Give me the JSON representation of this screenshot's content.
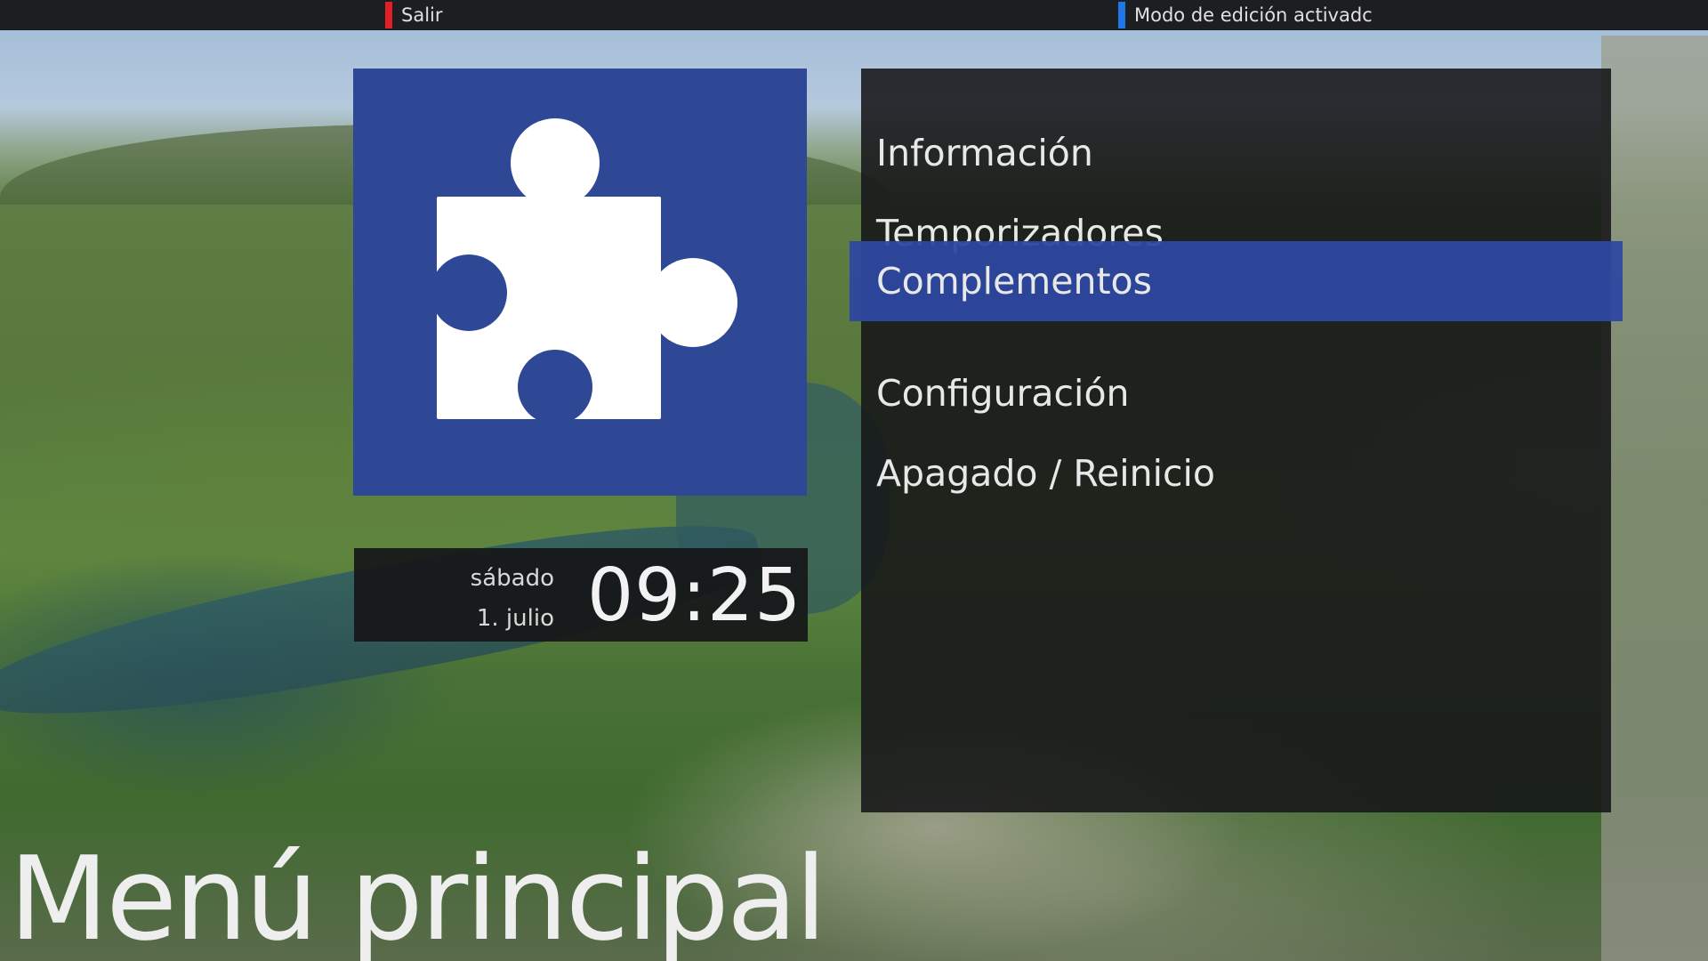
{
  "topbar": {
    "red_hint": {
      "label": "Salir",
      "color": "#e01f26"
    },
    "blue_hint": {
      "label": "Modo de edición activadc",
      "color": "#1f78e8"
    }
  },
  "tile": {
    "icon": "puzzle-piece-icon",
    "background_color": "#2e4896"
  },
  "clock": {
    "weekday": "sábado",
    "date": "1. julio",
    "time": "09:25"
  },
  "menu": {
    "items": [
      {
        "label": "Información"
      },
      {
        "label": "Temporizadores"
      },
      {
        "label": "Complementos"
      },
      {
        "label": "Configuración"
      },
      {
        "label": "Apagado / Reinicio"
      }
    ],
    "selected_index": 2,
    "selection_color": "#2e48a0"
  },
  "title": "Menú principal"
}
